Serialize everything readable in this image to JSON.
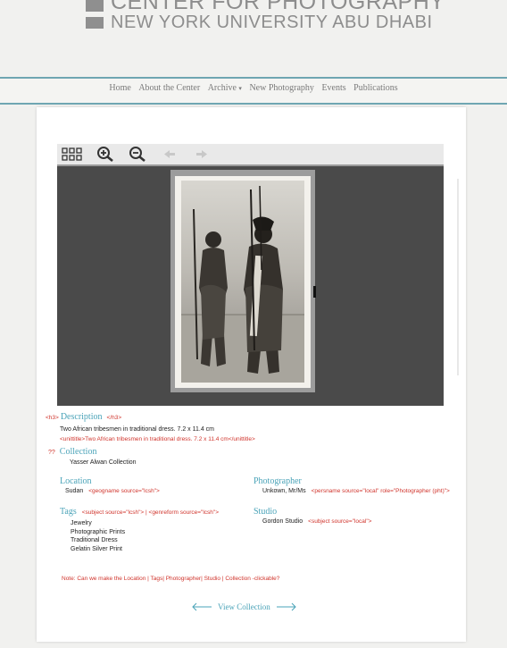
{
  "header": {
    "logo_line1": "CENTER FOR PHOTOGRAPHY",
    "logo_line2": "NEW YORK UNIVERSITY ABU DHABI"
  },
  "nav": {
    "items": [
      "Home",
      "About the Center",
      "Archive",
      "New Photography",
      "Events",
      "Publications"
    ]
  },
  "colors": {
    "accent": "#4aa3b8",
    "annotation": "#d0342c"
  },
  "toolbar": {
    "icons": [
      "grid-icon",
      "zoom-in-icon",
      "zoom-out-icon",
      "previous-arrow-icon",
      "next-arrow-icon"
    ]
  },
  "record": {
    "description": {
      "h3_open": "<h3>",
      "label": "Description",
      "h3_close": "</h3>",
      "text": "Two African tribesmen in traditional dress. 7.2 x 11.4 cm",
      "code": "<unittitle>Two African tribesmen in traditional dress. 7.2 x 11.4 cm</unittitle>"
    },
    "collection": {
      "marker": "??",
      "label": "Collection",
      "value": "Yasser Alwan Collection"
    },
    "location": {
      "label": "Location",
      "value": "Sudan",
      "code": "<geogname source=\"lcsh\">"
    },
    "photographer": {
      "label": "Photographer",
      "value": "Unkown, Mr/Ms",
      "code": "<persname source=\"local\" role=\"Photographer (pht)\">"
    },
    "tags": {
      "label": "Tags",
      "code": "<subject source=\"lcsh\"> | <genreform source=\"lcsh\">",
      "values": [
        "Jewelry",
        "Photographic Prints",
        "Traditional Dress",
        "Gelatin Silver Print"
      ]
    },
    "studio": {
      "label": "Studio",
      "value": "Gordon Studio",
      "code": "<subject source=\"local\">"
    },
    "note": "Note:  Can we make the Location | Tags| Photographer| Studio | Collection -clickable?",
    "view_collection": "View Collection"
  }
}
